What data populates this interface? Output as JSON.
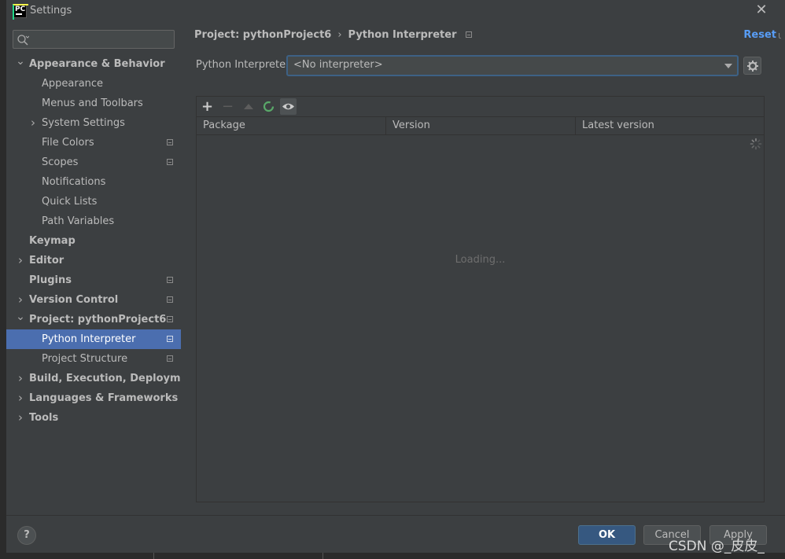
{
  "window": {
    "title": "Settings",
    "app_icon_text": "PC"
  },
  "sidebar": {
    "search_placeholder": "",
    "items": [
      {
        "label": "Appearance & Behavior",
        "level": 0,
        "expanded": true,
        "bold": true
      },
      {
        "label": "Appearance",
        "level": 1
      },
      {
        "label": "Menus and Toolbars",
        "level": 1
      },
      {
        "label": "System Settings",
        "level": 1,
        "collapsed": true
      },
      {
        "label": "File Colors",
        "level": 1,
        "project_icon": true
      },
      {
        "label": "Scopes",
        "level": 1,
        "project_icon": true
      },
      {
        "label": "Notifications",
        "level": 1
      },
      {
        "label": "Quick Lists",
        "level": 1
      },
      {
        "label": "Path Variables",
        "level": 1
      },
      {
        "label": "Keymap",
        "level": 0,
        "bold": true
      },
      {
        "label": "Editor",
        "level": 0,
        "collapsed": true,
        "bold": true
      },
      {
        "label": "Plugins",
        "level": 0,
        "bold": true,
        "project_icon": true
      },
      {
        "label": "Version Control",
        "level": 0,
        "collapsed": true,
        "bold": true,
        "project_icon": true
      },
      {
        "label": "Project: pythonProject6",
        "level": 0,
        "expanded": true,
        "bold": true,
        "project_icon": true
      },
      {
        "label": "Python Interpreter",
        "level": 1,
        "selected": true,
        "project_icon": true
      },
      {
        "label": "Project Structure",
        "level": 1,
        "project_icon": true
      },
      {
        "label": "Build, Execution, Deployment",
        "level": 0,
        "collapsed": true,
        "bold": true
      },
      {
        "label": "Languages & Frameworks",
        "level": 0,
        "collapsed": true,
        "bold": true
      },
      {
        "label": "Tools",
        "level": 0,
        "collapsed": true,
        "bold": true
      }
    ]
  },
  "breadcrumb": {
    "project": "Project: pythonProject6",
    "separator": "›",
    "page": "Python Interpreter"
  },
  "reset_label": "Reset",
  "interpreter": {
    "label": "Python Interpreter:",
    "value": "<No interpreter>"
  },
  "packages": {
    "columns": [
      "Package",
      "Version",
      "Latest version"
    ],
    "loading_text": "Loading..."
  },
  "footer": {
    "help": "?",
    "ok": "OK",
    "cancel": "Cancel",
    "apply": "Apply"
  },
  "watermark": "CSDN @_皮皮_",
  "colors": {
    "selection": "#4b6eaf",
    "link": "#589df6",
    "ok_button": "#365880",
    "background": "#3c3f41"
  }
}
